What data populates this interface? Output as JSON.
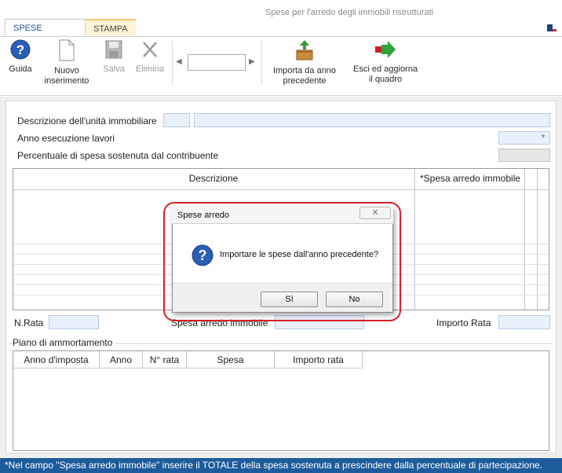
{
  "window": {
    "title": "Spese per l'arredo degli immobili ristrutturati"
  },
  "tabs": [
    {
      "label": "SPESE ARREDO"
    },
    {
      "label": "STAMPA"
    }
  ],
  "ribbon": {
    "guida": "Guida",
    "nuovo_1": "Nuovo",
    "nuovo_2": "inserimento",
    "salva": "Salva",
    "elimina": "Elimina",
    "nav_value": "",
    "importa_1": "Importa da anno",
    "importa_2": "precedente",
    "esci_1": "Esci ed aggiorna",
    "esci_2": "il quadro"
  },
  "form": {
    "descrizione_unita": "Descrizione dell'unità immobiliare",
    "anno_lavori": "Anno esecuzione lavori",
    "percentuale": "Percentuale di spesa sostenuta dal contribuente"
  },
  "grid": {
    "col_descrizione": "Descrizione",
    "col_spesa": "*Spesa arredo immobile"
  },
  "bottom": {
    "n_rata": "N.Rata",
    "spesa_arredo": "Spesa arredo immobile",
    "importo_rata": "Importo Rata"
  },
  "piano": {
    "title": "Piano di ammortamento",
    "columns": [
      "Anno d'imposta",
      "Anno",
      "N° rata",
      "Spesa",
      "Importo rata"
    ]
  },
  "footer": {
    "note": "*Nel campo \"Spesa arredo immobile\" inserire il TOTALE della spesa sostenuta a prescindere dalla percentuale di partecipazione."
  },
  "dialog": {
    "title": "Spese arredo",
    "message": "Importare le spese dall'anno precedente?",
    "yes": "Sì",
    "no": "No"
  },
  "colors": {
    "accent": "#1d5c9c",
    "highlight": "#d81f26"
  }
}
